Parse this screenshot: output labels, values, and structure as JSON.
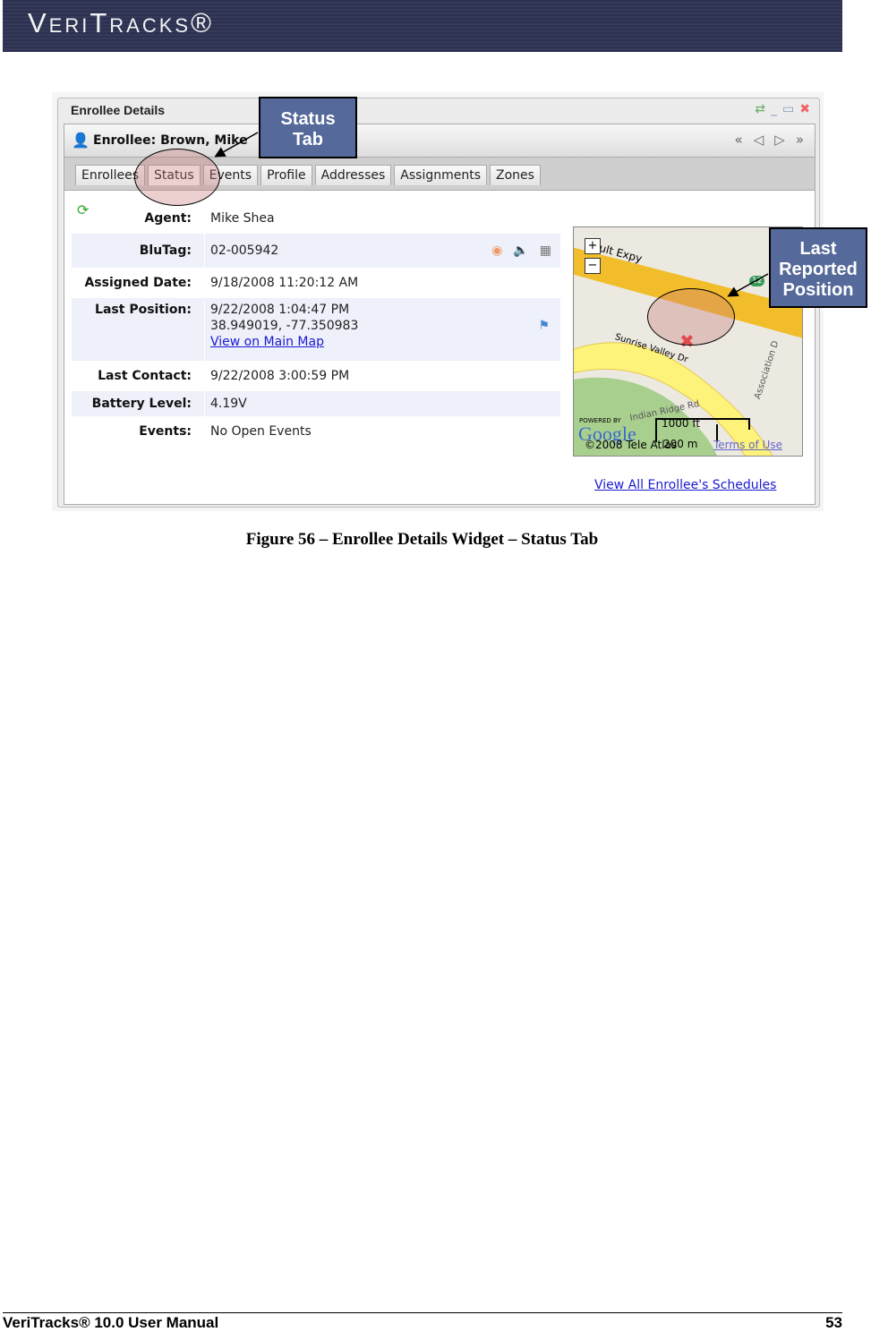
{
  "banner": {
    "logo": "VeriTracks®"
  },
  "widget": {
    "title": "Enrollee Details",
    "enrollee": "Enrollee: Brown, Mike",
    "tabs": [
      "Enrollees",
      "Status",
      "Events",
      "Profile",
      "Addresses",
      "Assignments",
      "Zones"
    ],
    "active_tab": "Status",
    "fields": [
      {
        "label": "Agent:",
        "value": "Mike Shea"
      },
      {
        "label": "BluTag:",
        "value": "02-005942"
      },
      {
        "label": "Assigned Date:",
        "value": "9/18/2008 11:20:12 AM"
      },
      {
        "label": "Last Position:",
        "value": "9/22/2008 1:04:47 PM",
        "coords": "38.949019, -77.350983",
        "link": "View on Main Map"
      },
      {
        "label": "Last Contact:",
        "value": "9/22/2008 3:00:59 PM"
      },
      {
        "label": "Battery Level:",
        "value": "4.19V"
      },
      {
        "label": "Events:",
        "value": "No Open Events"
      }
    ],
    "map": {
      "road1": "ult Expy",
      "road2": "Sunrise Valley Dr",
      "road3": "Indian Ridge Rd",
      "road4": "Association D",
      "route": "12",
      "scale_ft": "1000 ft",
      "scale_m": "200 m",
      "powered": "POWERED BY",
      "google": "Google",
      "copyright": "©2008 Tele Atlas",
      "terms": "Terms of Use"
    },
    "schedules_link": "View All Enrollee's Schedules"
  },
  "callouts": {
    "status": "Status Tab",
    "position": "Last Reported Position"
  },
  "caption": "Figure 56 – Enrollee Details Widget – Status Tab",
  "footer": {
    "title": "VeriTracks® 10.0 User Manual",
    "page": "53"
  }
}
